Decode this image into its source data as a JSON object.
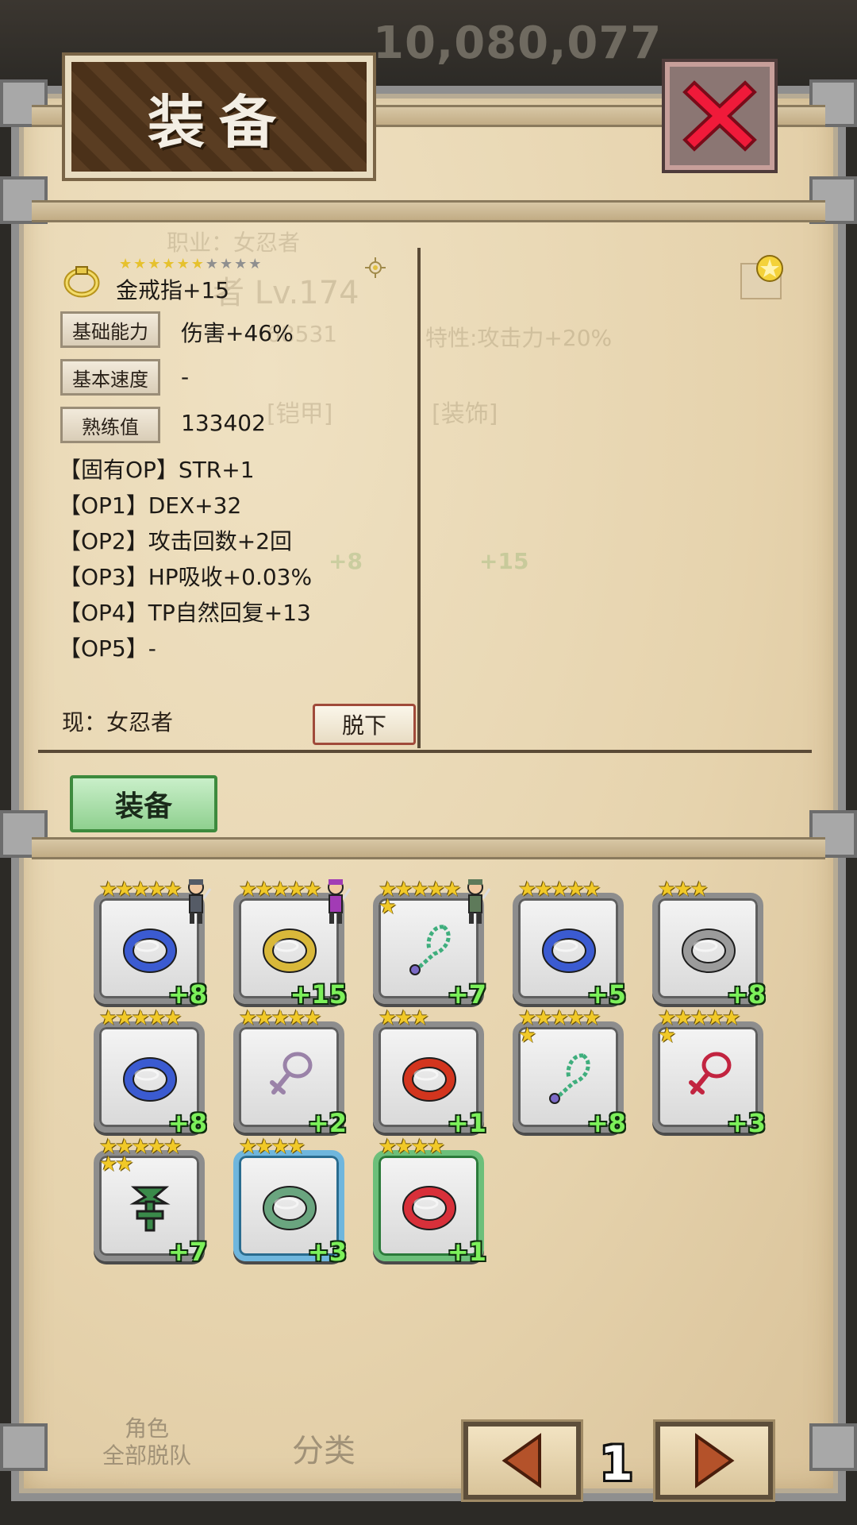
{
  "hud": {
    "gold": "10,080,077"
  },
  "title": "装备",
  "background_ghost": {
    "job": "职业：女忍者",
    "level": "者 Lv.174",
    "hp": "68531",
    "trait": "特性:攻击力+20%",
    "slot_armor": "[铠甲]",
    "slot_accessory": "[装饰]",
    "armor_plus": "+8",
    "accessory_plus": "+15",
    "bottom_btn1": "角色\n全部脱队",
    "bottom_btn2": "分类"
  },
  "item": {
    "name": "金戒指+15",
    "stars_total": 10,
    "stars_filled": 6,
    "stats": [
      {
        "label": "基础能力",
        "value": "伤害+46%"
      },
      {
        "label": "基本速度",
        "value": "-"
      },
      {
        "label": "熟练值",
        "value": "133402"
      }
    ],
    "options": [
      "【固有OP】STR+1",
      "【OP1】DEX+32",
      "【OP2】攻击回数+2回",
      "【OP3】HP吸收+0.03%",
      "【OP4】TP自然回复+13",
      "【OP5】-"
    ],
    "current": "现：女忍者",
    "unequip_label": "脱下"
  },
  "equip_tab": "装备",
  "inventory": [
    {
      "kind": "ring",
      "color": "#3b5bd1",
      "stars": 5,
      "plus": "+8",
      "frame": "gray",
      "equipped_by": "male"
    },
    {
      "kind": "ring",
      "color": "#d9b83a",
      "stars": 5,
      "plus": "+15",
      "frame": "gray",
      "equipped_by": "female"
    },
    {
      "kind": "necklace",
      "color": "#3fae7d",
      "stars": 6,
      "plus": "+7",
      "frame": "gray",
      "equipped_by": "zombie"
    },
    {
      "kind": "ring",
      "color": "#3b5bd1",
      "stars": 5,
      "plus": "+5",
      "frame": "gray",
      "equipped_by": ""
    },
    {
      "kind": "ring",
      "color": "#9b9b9b",
      "stars": 3,
      "plus": "+8",
      "frame": "gray",
      "equipped_by": ""
    },
    {
      "kind": "ring",
      "color": "#3b5bd1",
      "stars": 5,
      "plus": "+8",
      "frame": "gray",
      "equipped_by": ""
    },
    {
      "kind": "cross",
      "color": "#9a82a8",
      "stars": 5,
      "plus": "+2",
      "frame": "gray",
      "equipped_by": ""
    },
    {
      "kind": "ring",
      "color": "#d3351e",
      "stars": 3,
      "plus": "+1",
      "frame": "gray",
      "equipped_by": ""
    },
    {
      "kind": "necklace",
      "color": "#3fae7d",
      "stars": 6,
      "plus": "+8",
      "frame": "gray",
      "equipped_by": ""
    },
    {
      "kind": "cross",
      "color": "#c22440",
      "stars": 6,
      "plus": "+3",
      "frame": "gray",
      "equipped_by": ""
    },
    {
      "kind": "ankh",
      "color": "#3a8a4a",
      "stars": 7,
      "plus": "+7",
      "frame": "gray",
      "equipped_by": ""
    },
    {
      "kind": "ring",
      "color": "#6aa57f",
      "stars": 4,
      "plus": "+3",
      "frame": "blue",
      "equipped_by": ""
    },
    {
      "kind": "ring",
      "color": "#d8303a",
      "stars": 4,
      "plus": "+1",
      "frame": "green",
      "equipped_by": ""
    }
  ],
  "pager": {
    "page": "1"
  }
}
